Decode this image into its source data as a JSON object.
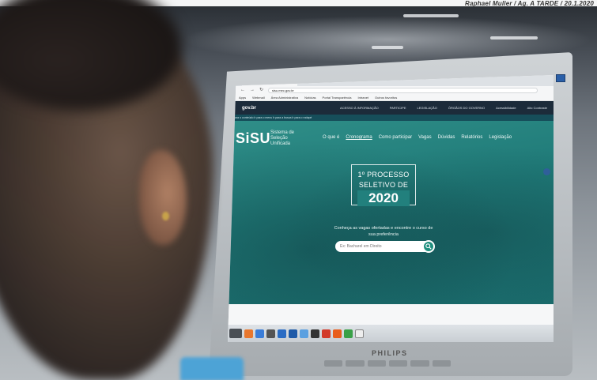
{
  "credit": "Raphael Muller / Ag. A TARDE / 20.1.2020",
  "monitor": {
    "brand": "PHILIPS"
  },
  "browser": {
    "tab_title": "Sisu - Sistema de Seleção Unif…",
    "tab_new": "+",
    "url": "sisu.mec.gov.br",
    "bookmarks": [
      "Apps",
      "Webmail",
      "Área Administrativa",
      "Notícias",
      "Portal Transparência",
      "Intranet",
      "Outros favoritos"
    ]
  },
  "gov_bar": {
    "logo": "gov.br",
    "items": [
      "ACESSO À INFORMAÇÃO",
      "PARTICIPE",
      "LEGISLAÇÃO",
      "ÓRGÃOS DO GOVERNO",
      "Acessibilidade",
      "Alto Contraste"
    ]
  },
  "breadcrumb": "Ir para o conteúdo   Ir para o menu   Ir para a busca   Ir para o rodapé",
  "site": {
    "logo": "SiSU",
    "tagline": "Sistema de Seleção Unificada",
    "nav": [
      "O que é",
      "Cronograma",
      "Como participar",
      "Vagas",
      "Dúvidas",
      "Relatórios",
      "Legislação"
    ],
    "active_nav_index": 1,
    "hero_line1": "1º PROCESSO",
    "hero_line2": "SELETIVO DE",
    "hero_year": "2020",
    "hero_copy": "Conheça as vagas ofertadas e encontre o curso de sua preferência",
    "search_placeholder": "Ex: Bacharel em Direito"
  },
  "colors": {
    "hero_teal": "#1f7a78",
    "gov_bar": "#1c2b3a",
    "search_button": "#1f8f7e"
  },
  "icons": {
    "search_button": "search-icon",
    "side_button": "accessibility-icon"
  }
}
